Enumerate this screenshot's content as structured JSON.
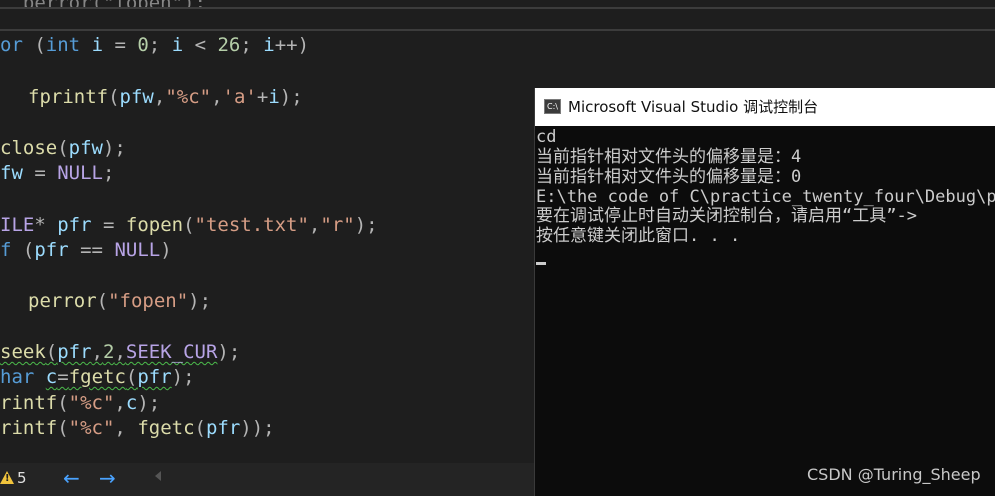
{
  "editor": {
    "top_partial_line": "  perror(\"fopen\");",
    "code": {
      "l1": {
        "a": "or",
        "b": " (",
        "c": "int",
        "d": " ",
        "e": "i",
        "f": " = ",
        "g": "0",
        "h": "; ",
        "i": "i",
        "j": " < ",
        "k": "26",
        "l": "; ",
        "m": "i",
        "n": "++)"
      },
      "l2": {
        "a": "fprintf",
        "b": "(",
        "c": "pfw",
        "d": ",",
        "e": "\"%c\"",
        "f": ",",
        "g": "'a'",
        "h": "+",
        "i": "i",
        "j": ");"
      },
      "l3": {
        "a": "close",
        "b": "(",
        "c": "pfw",
        "d": ");"
      },
      "l4": {
        "a": "fw",
        "b": " = ",
        "c": "NULL",
        "d": ";"
      },
      "l5": {
        "a": "ILE",
        "b": "* ",
        "c": "pfr",
        "d": " = ",
        "e": "fopen",
        "f": "(",
        "g": "\"test.txt\"",
        "h": ",",
        "i": "\"r\"",
        "j": ");"
      },
      "l6": {
        "a": "f",
        "b": " (",
        "c": "pfr",
        "d": " == ",
        "e": "NULL",
        "f": ")"
      },
      "l7": {
        "a": "perror",
        "b": "(",
        "c": "\"fopen\"",
        "d": ");"
      },
      "l8": {
        "a": "seek",
        "b": "(",
        "c": "pfr",
        "d": ",",
        "e": "2",
        "f": ",",
        "g": "SEEK_CUR",
        "h": ");"
      },
      "l9": {
        "a": "har",
        "b": " ",
        "c": "c",
        "d": "=",
        "e": "fgetc",
        "f": "(",
        "g": "pfr",
        "h": ");"
      },
      "l10": {
        "a": "rintf",
        "b": "(",
        "c": "\"%c\"",
        "d": ",",
        "e": "c",
        "f": ");"
      },
      "l11": {
        "a": "rintf",
        "b": "(",
        "c": "\"%c\"",
        "d": ", ",
        "e": "fgetc",
        "f": "(",
        "g": "pfr",
        "h": "));"
      }
    },
    "status": {
      "warning_count": "5",
      "back_arrow": "←",
      "forward_arrow": "→"
    }
  },
  "console": {
    "icon_text": "C:\\",
    "title": "Microsoft Visual Studio 调试控制台",
    "lines": [
      "cd",
      "当前指针相对文件头的偏移量是：4",
      "当前指针相对文件头的偏移量是：0",
      "E:\\the code of C\\practice_twenty_four\\Debug\\pra",
      "要在调试停止时自动关闭控制台，请启用“工具”->",
      "按任意键关闭此窗口. . ."
    ]
  },
  "watermark": "CSDN @Turing_Sheep",
  "colors": {
    "editor_bg": "#1e1e1e",
    "keyword": "#569cd6",
    "string": "#d69d85",
    "function": "#dcdcaa",
    "variable": "#9cdcfe",
    "macro": "#b8a4e6",
    "number": "#b5cea8",
    "console_bg": "#0c0c0c",
    "warning": "#f0c33c",
    "nav_arrow": "#4aa3ff"
  },
  "icons": {
    "warning": "warning-icon",
    "back": "back-arrow-icon",
    "forward": "forward-arrow-icon",
    "console": "console-app-icon"
  }
}
